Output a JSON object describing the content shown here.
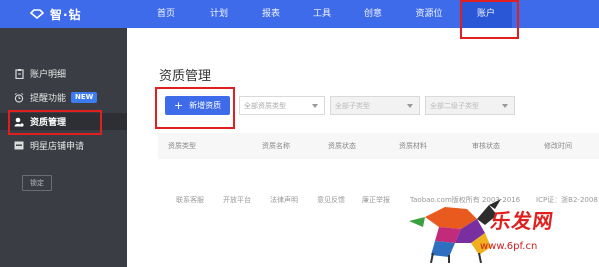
{
  "brand": {
    "name": "智·钻"
  },
  "nav": {
    "items": [
      {
        "label": "首页"
      },
      {
        "label": "计划"
      },
      {
        "label": "报表"
      },
      {
        "label": "工具"
      },
      {
        "label": "创意"
      },
      {
        "label": "资源位"
      },
      {
        "label": "账户"
      }
    ]
  },
  "sidebar": {
    "items": [
      {
        "label": "账户明细",
        "icon": "clipboard-icon"
      },
      {
        "label": "提醒功能",
        "icon": "alarm-icon",
        "badge": "NEW"
      },
      {
        "label": "资质管理",
        "icon": "user-icon"
      },
      {
        "label": "明星店铺申请",
        "icon": "card-icon"
      }
    ],
    "lock_label": "锁定"
  },
  "main": {
    "title": "资质管理",
    "new_button": "新增资质",
    "filters": [
      {
        "placeholder": "全部资质类型"
      },
      {
        "placeholder": "全部子类型"
      },
      {
        "placeholder": "全部二级子类型"
      }
    ],
    "columns": [
      "资质类型",
      "资质名称",
      "资质状态",
      "资质材料",
      "审核状态",
      "修改时间"
    ]
  },
  "footer": {
    "links": [
      "联系客服",
      "开放平台",
      "法律声明",
      "意见反馈",
      "廉正举报",
      "Taobao.com版权所有 2003-2016",
      "ICP证：浙B2-2008"
    ]
  },
  "watermark": {
    "text": "乐发网",
    "url": "www.6pf.cn"
  },
  "colors": {
    "primary": "#3d6bea",
    "sidebar_bg": "#3a3d44",
    "highlight_frame": "#e02020"
  }
}
